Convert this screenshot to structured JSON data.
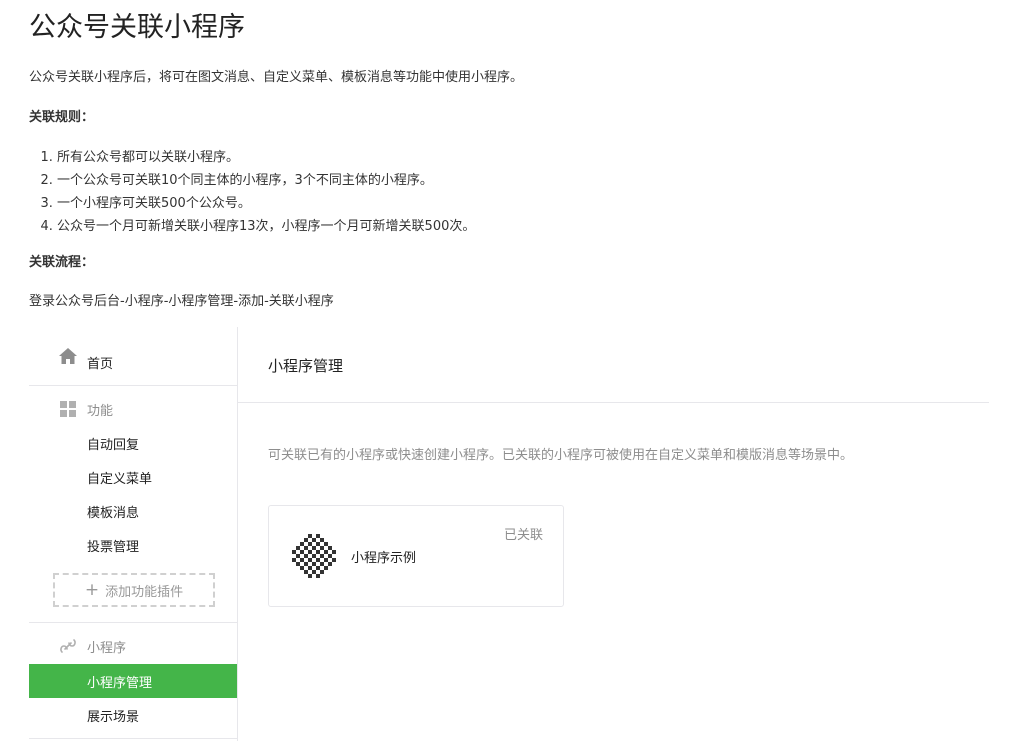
{
  "doc": {
    "title": "公众号关联小程序",
    "intro": "公众号关联小程序后，将可在图文消息、自定义菜单、模板消息等功能中使用小程序。",
    "rules_heading": "关联规则：",
    "rules": [
      "所有公众号都可以关联小程序。",
      "一个公众号可关联10个同主体的小程序，3个不同主体的小程序。",
      "一个小程序可关联500个公众号。",
      "公众号一个月可新增关联小程序13次，小程序一个月可新增关联500次。"
    ],
    "flow_heading": "关联流程：",
    "flow_text": "登录公众号后台-小程序-小程序管理-添加-关联小程序"
  },
  "sidebar": {
    "home": {
      "label": "首页",
      "icon": "home-icon"
    },
    "features": {
      "label": "功能",
      "icon": "grid-icon",
      "items": [
        "自动回复",
        "自定义菜单",
        "模板消息",
        "投票管理"
      ],
      "add_plugin_label": "添加功能插件"
    },
    "miniprogram": {
      "label": "小程序",
      "icon": "link-icon",
      "items": [
        "小程序管理",
        "展示场景"
      ],
      "active_index": 0
    }
  },
  "main": {
    "title": "小程序管理",
    "description": "可关联已有的小程序或快速创建小程序。已关联的小程序可被使用在自定义菜单和模版消息等场景中。",
    "card": {
      "status": "已关联",
      "name": "小程序示例",
      "icon": "qr-code-icon"
    }
  },
  "colors": {
    "accent": "#44b549",
    "border": "#e7e7eb",
    "muted_text": "#8d8d8d"
  }
}
